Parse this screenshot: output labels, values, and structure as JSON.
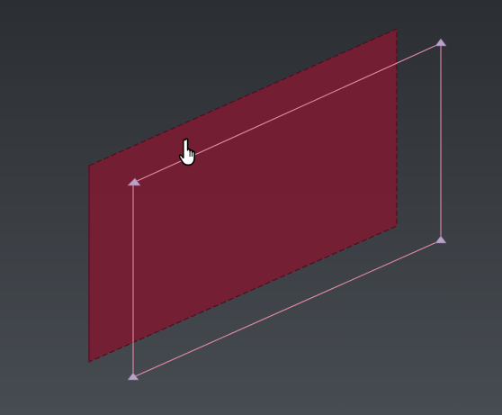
{
  "viewport": {
    "background_top": "#2b2e32",
    "background_bottom": "#474c52"
  },
  "plane": {
    "fill_color": "#7a1c33",
    "edge_color": "#4a0f1f"
  },
  "selection_box": {
    "line_color": "#e58aa6",
    "handle_color": "#b9a3c9",
    "handle_count": 4
  },
  "cursor": {
    "icon": "pointing-hand-icon",
    "fill": "#ffffff",
    "outline": "#000000"
  }
}
